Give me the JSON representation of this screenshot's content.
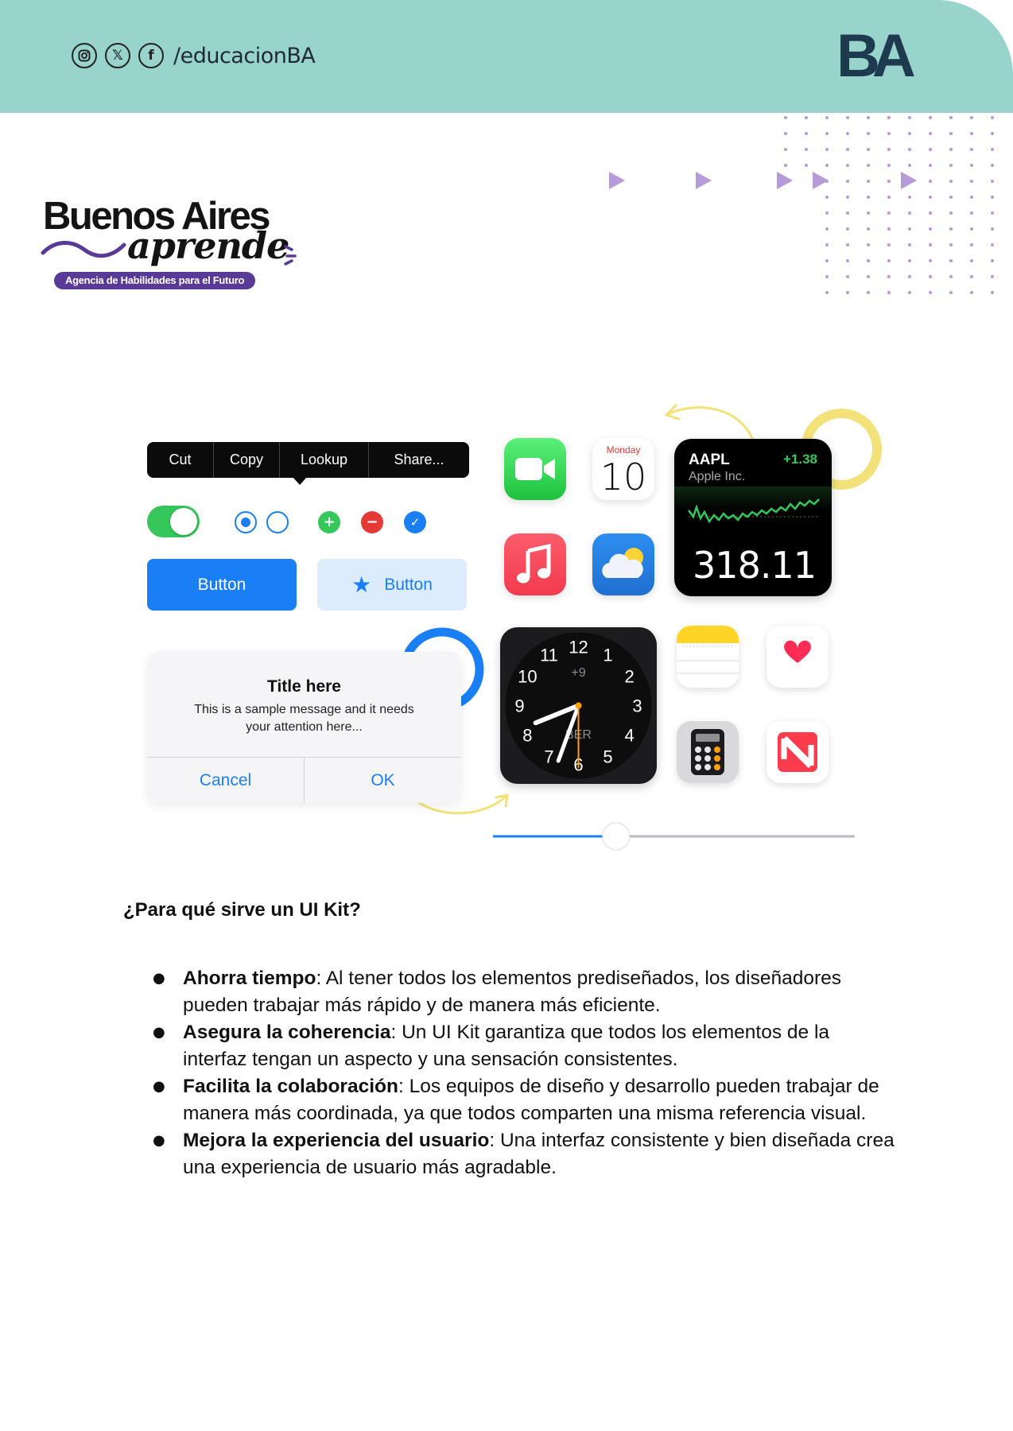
{
  "header": {
    "social_icons": [
      "instagram-icon",
      "x-icon",
      "facebook-icon"
    ],
    "x_glyph": "𝕏",
    "fb_glyph": "f",
    "handle": "/educacionBA",
    "logo_text": "BA"
  },
  "brand": {
    "title": "Buenos Aires",
    "script": "aprende",
    "tagline": "Agencia de Habilidades para el Futuro"
  },
  "ui_kit": {
    "context_menu": [
      "Cut",
      "Copy",
      "Lookup",
      "Share..."
    ],
    "toggle_on": true,
    "radios": [
      true,
      false
    ],
    "round_buttons": {
      "add": "+",
      "remove": "−",
      "check": "✓"
    },
    "button_primary": "Button",
    "button_secondary": "Button",
    "alert": {
      "title": "Title here",
      "message": "This is a sample message and it needs your attention here...",
      "cancel": "Cancel",
      "ok": "OK"
    },
    "calendar": {
      "day": "Monday",
      "date": "10"
    },
    "stocks": {
      "symbol": "AAPL",
      "change": "+1.38",
      "name": "Apple Inc.",
      "price": "318.11"
    },
    "clock": {
      "numbers": [
        "12",
        "1",
        "2",
        "3",
        "4",
        "5",
        "6",
        "7",
        "8",
        "9",
        "10",
        "11"
      ],
      "offset": "+9",
      "label": "BER"
    },
    "slider_fraction": 0.34,
    "colors": {
      "accent_blue": "#1a7ef5",
      "green": "#35c759",
      "red": "#e53935",
      "teal_header": "#98d4cc",
      "purple": "#5a3a97"
    }
  },
  "content": {
    "question": "¿Para qué sirve un UI Kit?",
    "bullets": [
      {
        "term": "Ahorra tiempo",
        "text": ": Al tener todos los elementos prediseñados, los diseñadores pueden trabajar más rápido y de manera más eficiente."
      },
      {
        "term": "Asegura la coherencia",
        "text": ": Un UI Kit garantiza que todos los elementos de la interfaz tengan un aspecto y una sensación consistentes."
      },
      {
        "term": "Facilita la colaboración",
        "text": ": Los equipos de diseño y desarrollo pueden trabajar de manera más coordinada, ya que todos comparten una misma referencia visual."
      },
      {
        "term": "Mejora la experiencia del usuario",
        "text": ": Una interfaz consistente y bien diseñada crea una experiencia de usuario más agradable."
      }
    ]
  }
}
